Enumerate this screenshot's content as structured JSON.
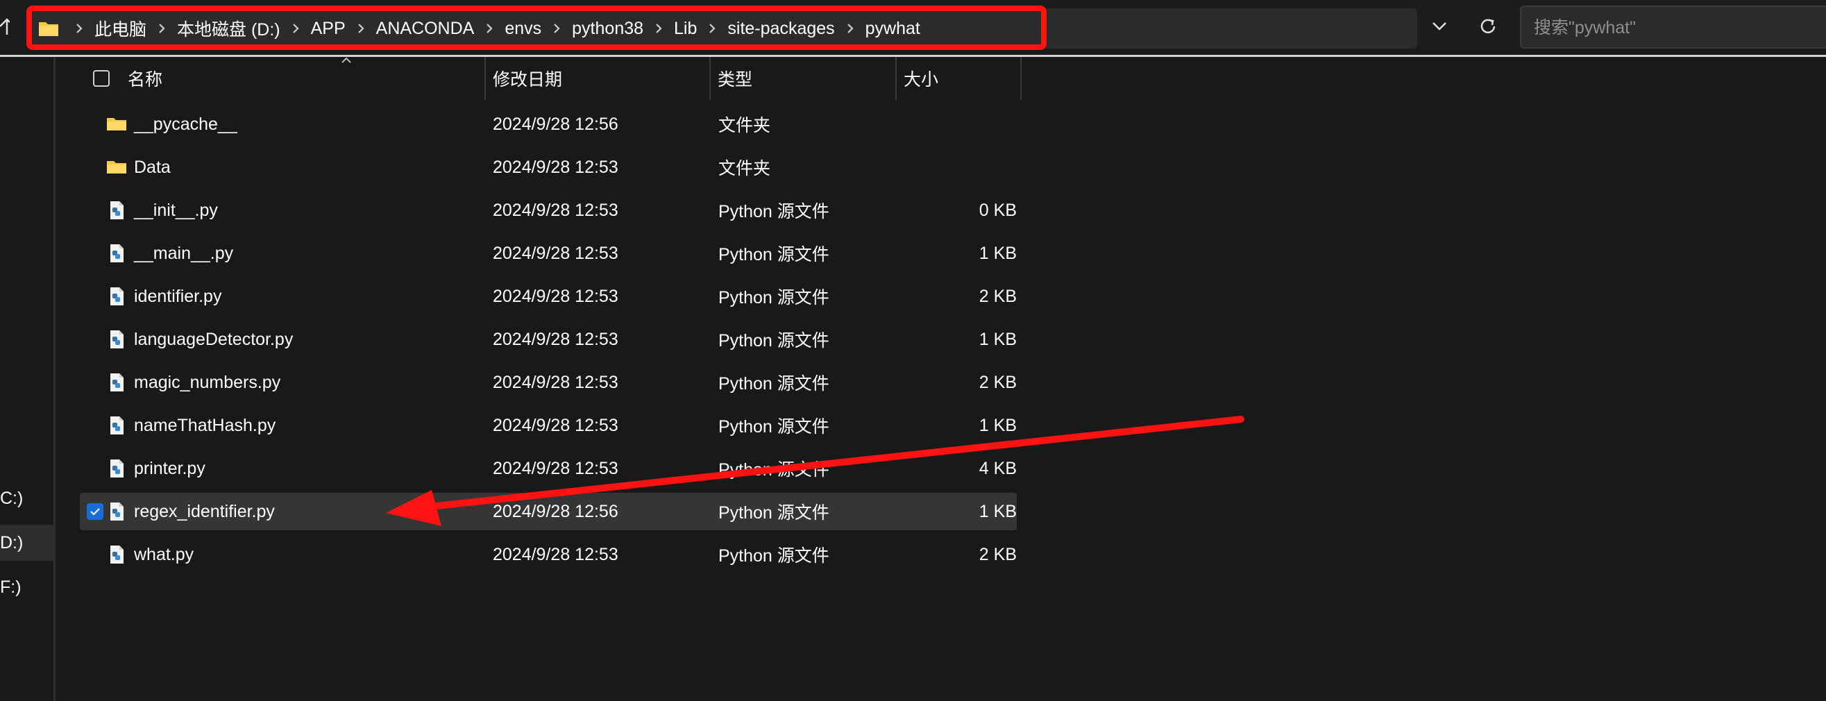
{
  "address_bar": {
    "breadcrumbs": [
      "此电脑",
      "本地磁盘 (D:)",
      "APP",
      "ANACONDA",
      "envs",
      "python38",
      "Lib",
      "site-packages",
      "pywhat"
    ]
  },
  "search": {
    "placeholder": "搜索\"pywhat\""
  },
  "left_pane": {
    "drives": [
      {
        "label": "C:)",
        "selected": false
      },
      {
        "label": "D:)",
        "selected": true
      },
      {
        "label": "F:)",
        "selected": false
      }
    ]
  },
  "columns": {
    "name": "名称",
    "date": "修改日期",
    "type": "类型",
    "size": "大小"
  },
  "files": [
    {
      "name": "__pycache__",
      "date": "2024/9/28 12:56",
      "type": "文件夹",
      "size": "",
      "kind": "folder-icon",
      "selected": false
    },
    {
      "name": "Data",
      "date": "2024/9/28 12:53",
      "type": "文件夹",
      "size": "",
      "kind": "folder-icon",
      "selected": false
    },
    {
      "name": "__init__.py",
      "date": "2024/9/28 12:53",
      "type": "Python 源文件",
      "size": "0 KB",
      "kind": "python-file-icon",
      "selected": false
    },
    {
      "name": "__main__.py",
      "date": "2024/9/28 12:53",
      "type": "Python 源文件",
      "size": "1 KB",
      "kind": "python-file-icon",
      "selected": false
    },
    {
      "name": "identifier.py",
      "date": "2024/9/28 12:53",
      "type": "Python 源文件",
      "size": "2 KB",
      "kind": "python-file-icon",
      "selected": false
    },
    {
      "name": "languageDetector.py",
      "date": "2024/9/28 12:53",
      "type": "Python 源文件",
      "size": "1 KB",
      "kind": "python-file-icon",
      "selected": false
    },
    {
      "name": "magic_numbers.py",
      "date": "2024/9/28 12:53",
      "type": "Python 源文件",
      "size": "2 KB",
      "kind": "python-file-icon",
      "selected": false
    },
    {
      "name": "nameThatHash.py",
      "date": "2024/9/28 12:53",
      "type": "Python 源文件",
      "size": "1 KB",
      "kind": "python-file-icon",
      "selected": false
    },
    {
      "name": "printer.py",
      "date": "2024/9/28 12:53",
      "type": "Python 源文件",
      "size": "4 KB",
      "kind": "python-file-icon",
      "selected": false
    },
    {
      "name": "regex_identifier.py",
      "date": "2024/9/28 12:56",
      "type": "Python 源文件",
      "size": "1 KB",
      "kind": "python-file-icon",
      "selected": true
    },
    {
      "name": "what.py",
      "date": "2024/9/28 12:53",
      "type": "Python 源文件",
      "size": "2 KB",
      "kind": "python-file-icon",
      "selected": false
    }
  ],
  "colors": {
    "annotation_red": "#ff1212",
    "background": "#191919",
    "selected_row": "#353535",
    "checkbox_blue": "#1a6cd6",
    "folder_yellow": "#f7c844"
  }
}
